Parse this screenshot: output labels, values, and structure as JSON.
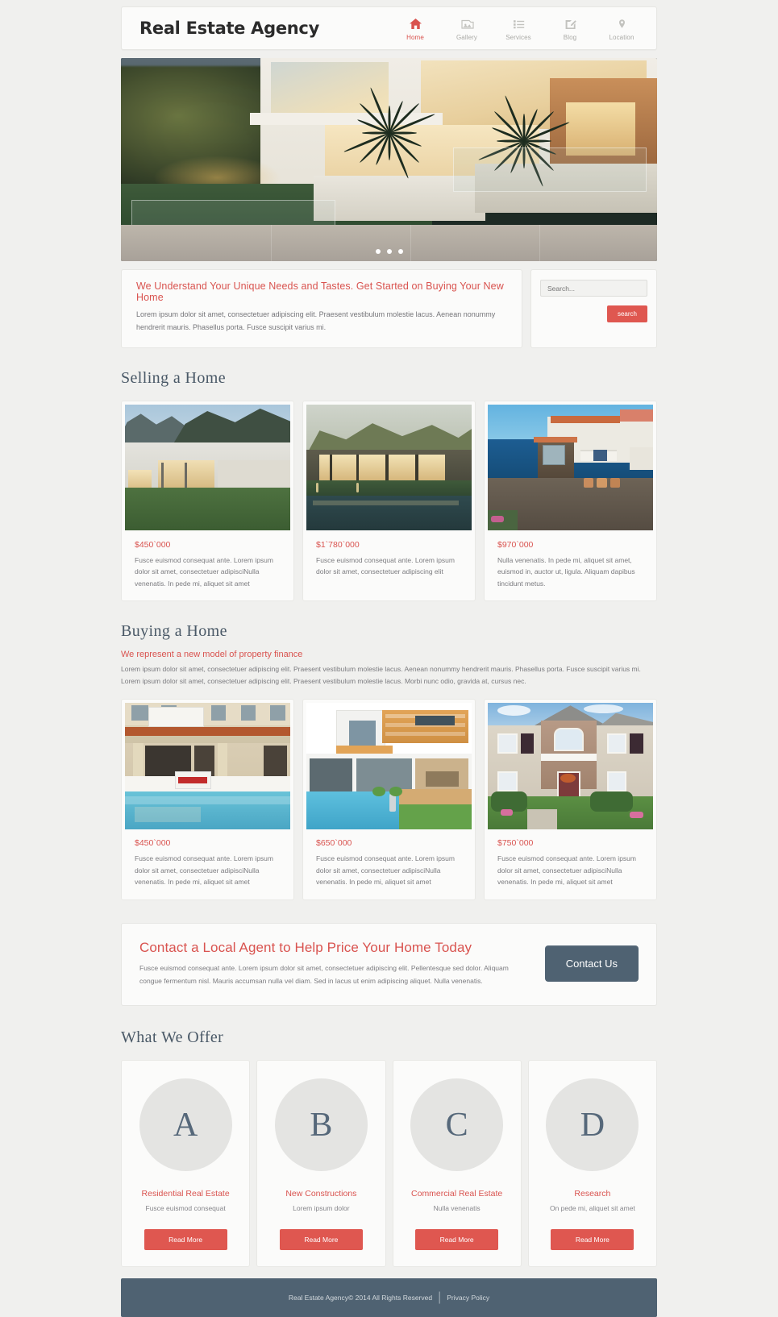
{
  "header": {
    "logo": "Real Estate Agency",
    "nav": [
      {
        "label": "Home",
        "icon": "home-icon",
        "active": true
      },
      {
        "label": "Gallery",
        "icon": "gallery-icon",
        "active": false
      },
      {
        "label": "Services",
        "icon": "list-icon",
        "active": false
      },
      {
        "label": "Blog",
        "icon": "pencil-edit-icon",
        "active": false
      },
      {
        "label": "Location",
        "icon": "map-pin-icon",
        "active": false
      }
    ]
  },
  "hero": {
    "alt": "Modern luxury home at dusk with palm trees and glass railing",
    "slides": 3,
    "active_slide": 1
  },
  "intro": {
    "title": "We Understand Your Unique Needs and Tastes. Get Started on Buying Your New Home",
    "text": "Lorem ipsum dolor sit amet, consectetuer adipiscing elit. Praesent vestibulum molestie lacus. Aenean nonummy hendrerit mauris. Phasellus porta. Fusce suscipit varius mi."
  },
  "search": {
    "placeholder": "Search...",
    "value": "",
    "button_label": "search"
  },
  "selling": {
    "heading": "Selling a Home",
    "cards": [
      {
        "price": "$450`000",
        "text": "Fusce euismod consequat ante. Lorem ipsum dolor sit amet, consectetuer adipisciNulla venenatis. In pede mi, aliquet sit amet",
        "image": "modern-house-mountain-lawn"
      },
      {
        "price": "$1`780`000",
        "text": "Fusce euismod consequat ante. Lorem ipsum dolor sit amet, consectetuer adipiscing elit",
        "image": "hillside-villa-pool-dusk"
      },
      {
        "price": "$970`000",
        "text": "Nulla venenatis. In pede mi, aliquet sit amet, euismod in, auctor ut, ligula. Aliquam dapibus tincidunt metus.",
        "image": "mediterranean-seaside-villa"
      }
    ]
  },
  "buying": {
    "heading": "Buying a Home",
    "subheading": "We represent a new model of property finance",
    "paragraph": "Lorem ipsum dolor sit amet, consectetuer adipiscing elit. Praesent vestibulum molestie lacus. Aenean nonummy hendrerit mauris. Phasellus porta. Fusce suscipit varius mi. Lorem ipsum dolor sit amet, consectetuer adipiscing elit. Praesent vestibulum molestie lacus. Morbi nunc odio, gravida at, cursus nec.",
    "cards": [
      {
        "price": "$450`000",
        "text": "Fusce euismod consequat ante. Lorem ipsum dolor sit amet, consectetuer adipisciNulla venenatis. In pede mi, aliquet sit amet",
        "image": "villa-for-sale-sign-pool",
        "sign_label": "FOR SALE"
      },
      {
        "price": "$650`000",
        "text": "Fusce euismod consequat ante. Lorem ipsum dolor sit amet, consectetuer adipisciNulla venenatis. In pede mi, aliquet sit amet",
        "image": "modern-wood-clad-house-pool"
      },
      {
        "price": "$750`000",
        "text": "Fusce euismod consequat ante. Lorem ipsum dolor sit amet, consectetuer adipisciNulla venenatis. In pede mi, aliquet sit amet",
        "image": "suburban-brick-colonial-home"
      }
    ]
  },
  "contact": {
    "title": "Contact a Local Agent to Help Price Your Home Today",
    "text": "Fusce euismod consequat ante. Lorem ipsum dolor sit amet, consectetuer adipiscing elit. Pellentesque sed dolor. Aliquam congue fermentum nisl. Mauris accumsan nulla vel diam. Sed in lacus ut enim adipiscing aliquet. Nulla venenatis.",
    "button_label": "Contact Us"
  },
  "offer": {
    "heading": "What We Offer",
    "items": [
      {
        "letter": "A",
        "title": "Residential Real Estate",
        "sub": "Fusce euismod consequat",
        "button_label": "Read More"
      },
      {
        "letter": "B",
        "title": "New Constructions",
        "sub": "Lorem ipsum dolor",
        "button_label": "Read More"
      },
      {
        "letter": "C",
        "title": "Commercial Real Estate",
        "sub": "Nulla venenatis",
        "button_label": "Read More"
      },
      {
        "letter": "D",
        "title": "Research",
        "sub": "On pede mi, aliquet sit amet",
        "button_label": "Read More"
      }
    ]
  },
  "footer": {
    "copyright": "Real Estate Agency© 2014 All Rights Reserved",
    "separator": "|",
    "privacy_label": "Privacy Policy"
  },
  "colors": {
    "accent_red": "#d9534f",
    "button_red": "#df5750",
    "slate": "#4f6272",
    "heading_slate": "#4a5967",
    "page_bg": "#f0f0ee",
    "card_bg": "#fbfbfa"
  }
}
